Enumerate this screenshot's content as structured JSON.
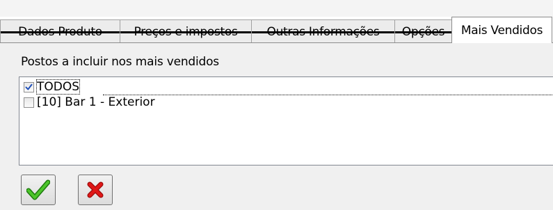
{
  "tabs": [
    {
      "label": "Dados Produto",
      "struck": true
    },
    {
      "label": "Preços e impostos",
      "struck": true
    },
    {
      "label": "Outras Informações",
      "struck": true
    },
    {
      "label": "Opções",
      "struck": true
    },
    {
      "label": "Mais Vendidos",
      "active": true
    }
  ],
  "panel": {
    "section_label": "Postos a incluir nos mais vendidos",
    "items": [
      {
        "label": "TODOS",
        "checked": true
      },
      {
        "label": "[10] Bar 1 - Exterior",
        "checked": false
      }
    ]
  },
  "buttons": {
    "ok_icon": "green-checkmark-icon",
    "cancel_icon": "red-x-icon"
  },
  "colors": {
    "ok_green": "#2e9e18",
    "cancel_red": "#d41414",
    "check_blue": "#1f4fb8"
  }
}
